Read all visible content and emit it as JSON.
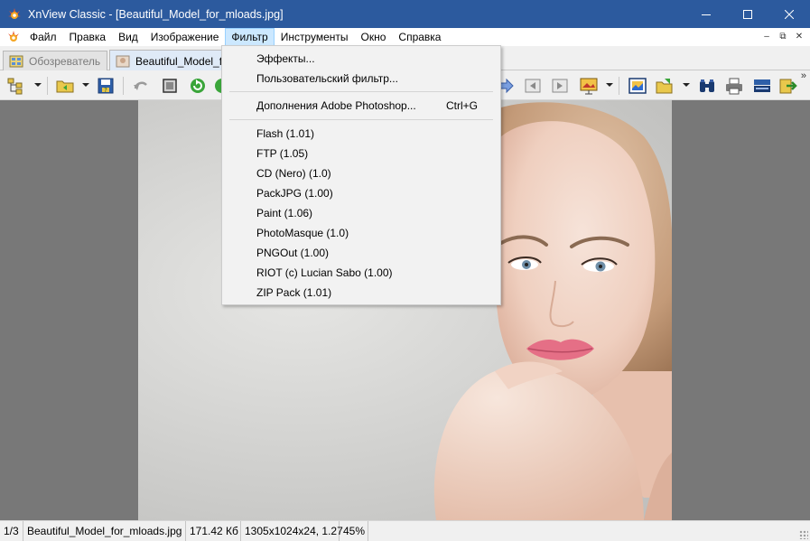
{
  "window": {
    "title": "XnView Classic - [Beautiful_Model_for_mloads.jpg]",
    "minimize": "—",
    "maximize": "☐",
    "close": "✕"
  },
  "menubar": {
    "items": [
      "Файл",
      "Правка",
      "Вид",
      "Изображение",
      "Фильтр",
      "Инструменты",
      "Окно",
      "Справка"
    ],
    "mdi": [
      "–",
      "⧉",
      "✕"
    ]
  },
  "tabs": [
    {
      "label": "Обозреватель"
    },
    {
      "label": "Beautiful_Model_f"
    }
  ],
  "toolbar": {
    "overflow": "»"
  },
  "filter_menu": {
    "items": [
      {
        "label": "Эффекты...",
        "shortcut": ""
      },
      {
        "label": "Пользовательский фильтр...",
        "shortcut": ""
      },
      {
        "label": "Дополнения Adobe Photoshop...",
        "shortcut": "Ctrl+G"
      },
      {
        "label": "Flash (1.01)",
        "shortcut": ""
      },
      {
        "label": "FTP (1.05)",
        "shortcut": ""
      },
      {
        "label": "CD (Nero) (1.0)",
        "shortcut": ""
      },
      {
        "label": "PackJPG (1.00)",
        "shortcut": ""
      },
      {
        "label": "Paint (1.06)",
        "shortcut": ""
      },
      {
        "label": "PhotoMasque (1.0)",
        "shortcut": ""
      },
      {
        "label": "PNGOut (1.00)",
        "shortcut": ""
      },
      {
        "label": "RIOT (c) Lucian Sabo (1.00)",
        "shortcut": ""
      },
      {
        "label": "ZIP Pack (1.01)",
        "shortcut": ""
      }
    ]
  },
  "statusbar": {
    "index": "1/3",
    "filename": "Beautiful_Model_for_mloads.jpg",
    "filesize": "171.42 Кб",
    "dimensions": "1305x1024x24, 1.27",
    "zoom": "45%"
  },
  "colors": {
    "titlebar": "#2c5a9e",
    "menu_highlight": "#cce8ff",
    "viewer_bg": "#787878"
  }
}
